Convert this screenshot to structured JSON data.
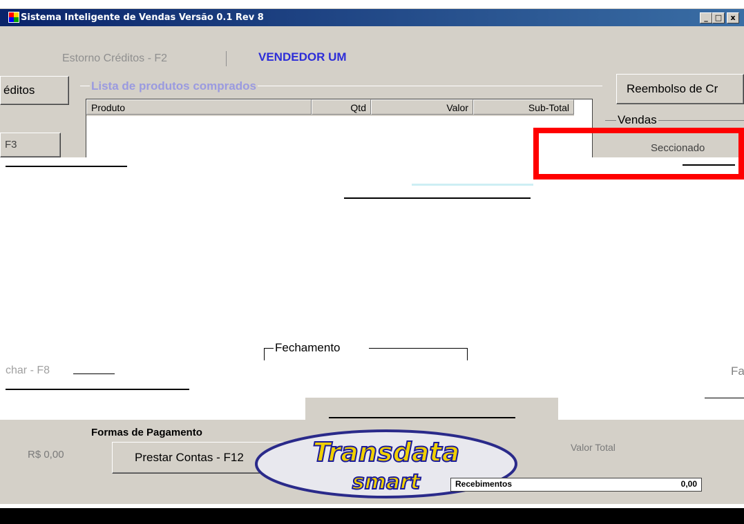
{
  "window": {
    "title": "Sistema Inteligente de Vendas Versão 0.1 Rev 8",
    "minimize": "_",
    "maximize": "□",
    "close": "x"
  },
  "header": {
    "estorno_creditos": "Estorno Créditos - F2",
    "vendedor": "VENDEDOR UM"
  },
  "buttons": {
    "creditos": "éditos",
    "reembolso": "Reembolso de Cr",
    "f3": "F3",
    "prestar_contas": "Prestar Contas - F12"
  },
  "products_group": {
    "legend": "Lista de produtos comprados",
    "columns": [
      "Produto",
      "Qtd",
      "Valor",
      "Sub-Total"
    ]
  },
  "vendas": {
    "legend": "Vendas",
    "seccionado": "Seccionado"
  },
  "fechamento": {
    "legend": "Fechamento",
    "fechar": "char - F8",
    "fa": "Fa"
  },
  "footer": {
    "formas": "Formas de Pagamento",
    "rs_value": "R$ 0,00",
    "valor_total": "Valor Total",
    "recebimentos": "Recebimentos",
    "recebimentos_value": "0,00",
    "logo_top": "Transdata",
    "logo_bottom": "smart"
  }
}
